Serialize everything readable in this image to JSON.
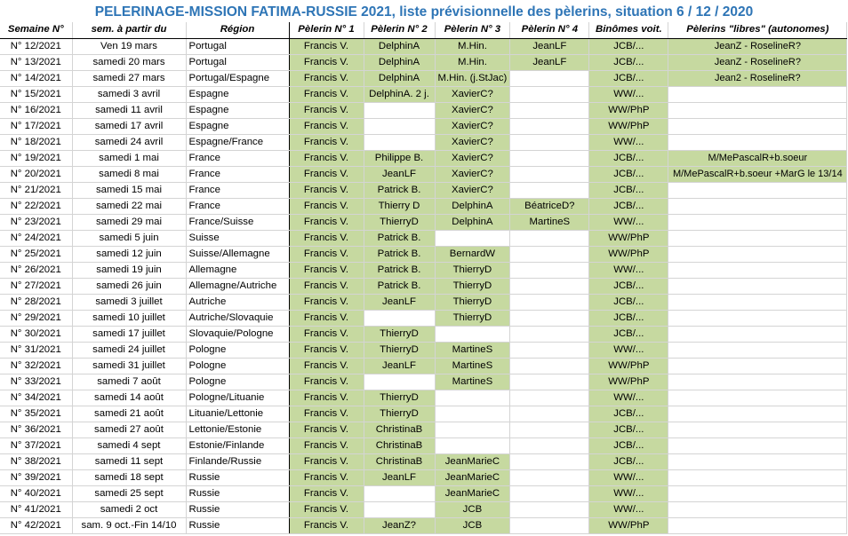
{
  "title": "PELERINAGE-MISSION FATIMA-RUSSIE 2021, liste prévisionnelle des pèlerins, situation 6 / 12 / 2020",
  "colors": {
    "title": "#2e75b6",
    "green_fill": "#c6d9a0"
  },
  "headers": [
    "Semaine N°",
    "sem. à partir du",
    "Région",
    "Pèlerin N° 1",
    "Pèlerin N° 2",
    "Pèlerin N° 3",
    "Pèlerin N° 4",
    "Binômes voit.",
    "Pèlerins \"libres\" (autonomes)"
  ],
  "rows": [
    {
      "week": "N° 12/2021",
      "date": "Ven 19 mars",
      "region": "Portugal",
      "p1": "Francis V.",
      "p2": "DelphinA",
      "p3": "M.Hin.",
      "p4": "JeanLF",
      "binome": "JCB/...",
      "libres": "JeanZ - RoselineR?"
    },
    {
      "week": "N° 13/2021",
      "date": "samedi 20 mars",
      "region": "Portugal",
      "p1": "Francis V.",
      "p2": "DelphinA",
      "p3": "M.Hin.",
      "p4": "JeanLF",
      "binome": "JCB/...",
      "libres": "JeanZ - RoselineR?"
    },
    {
      "week": "N° 14/2021",
      "date": "samedi 27 mars",
      "region": "Portugal/Espagne",
      "p1": "Francis V.",
      "p2": "DelphinA",
      "p3": "M.Hin. (j.StJac)",
      "p4": "",
      "binome": "JCB/...",
      "libres": "Jean2 - RoselineR?"
    },
    {
      "week": "N° 15/2021",
      "date": "samedi 3 avril",
      "region": "Espagne",
      "p1": "Francis V.",
      "p2": "DelphinA. 2 j.",
      "p3": "XavierC?",
      "p4": "",
      "binome": "WW/...",
      "libres": ""
    },
    {
      "week": "N° 16/2021",
      "date": "samedi 11 avril",
      "region": "Espagne",
      "p1": "Francis V.",
      "p2": "",
      "p3": "XavierC?",
      "p4": "",
      "binome": "WW/PhP",
      "libres": ""
    },
    {
      "week": "N° 17/2021",
      "date": "samedi 17 avril",
      "region": "Espagne",
      "p1": "Francis V.",
      "p2": "",
      "p3": "XavierC?",
      "p4": "",
      "binome": "WW/PhP",
      "libres": ""
    },
    {
      "week": "N° 18/2021",
      "date": "samedi 24 avril",
      "region": "Espagne/France",
      "p1": "Francis V.",
      "p2": "",
      "p3": "XavierC?",
      "p4": "",
      "binome": "WW/...",
      "libres": ""
    },
    {
      "week": "N° 19/2021",
      "date": "samedi 1 mai",
      "region": "France",
      "p1": "Francis V.",
      "p2": "Philippe B.",
      "p3": "XavierC?",
      "p4": "",
      "binome": "JCB/...",
      "libres": "M/MePascalR+b.soeur"
    },
    {
      "week": "N° 20/2021",
      "date": "samedi 8 mai",
      "region": "France",
      "p1": "Francis V.",
      "p2": "JeanLF",
      "p3": "XavierC?",
      "p4": "",
      "binome": "JCB/...",
      "libres": "M/MePascalR+b.soeur  +MarG le 13/14"
    },
    {
      "week": "N° 21/2021",
      "date": "samedi 15 mai",
      "region": "France",
      "p1": "Francis V.",
      "p2": "Patrick B.",
      "p3": "XavierC?",
      "p4": "",
      "binome": "JCB/...",
      "libres": ""
    },
    {
      "week": "N° 22/2021",
      "date": "samedi 22 mai",
      "region": "France",
      "p1": "Francis V.",
      "p2": "Thierry D",
      "p3": "DelphinA",
      "p4": "BéatriceD?",
      "binome": "JCB/...",
      "libres": ""
    },
    {
      "week": "N° 23/2021",
      "date": "samedi 29 mai",
      "region": "France/Suisse",
      "p1": "Francis V.",
      "p2": "ThierryD",
      "p3": "DelphinA",
      "p4": "MartineS",
      "binome": "WW/...",
      "libres": ""
    },
    {
      "week": "N° 24/2021",
      "date": "samedi 5 juin",
      "region": "Suisse",
      "p1": "Francis V.",
      "p2": "Patrick B.",
      "p3": "",
      "p4": "",
      "binome": "WW/PhP",
      "libres": ""
    },
    {
      "week": "N° 25/2021",
      "date": "samedi 12 juin",
      "region": "Suisse/Allemagne",
      "p1": "Francis V.",
      "p2": "Patrick B.",
      "p3": "BernardW",
      "p4": "",
      "binome": "WW/PhP",
      "libres": ""
    },
    {
      "week": "N° 26/2021",
      "date": "samedi 19 juin",
      "region": "Allemagne",
      "p1": "Francis V.",
      "p2": "Patrick B.",
      "p3": "ThierryD",
      "p4": "",
      "binome": "WW/...",
      "libres": ""
    },
    {
      "week": "N° 27/2021",
      "date": "samedi 26 juin",
      "region": "Allemagne/Autriche",
      "p1": "Francis V.",
      "p2": "Patrick B.",
      "p3": "ThierryD",
      "p4": "",
      "binome": "JCB/...",
      "libres": ""
    },
    {
      "week": "N° 28/2021",
      "date": "samedi 3 juillet",
      "region": "Autriche",
      "p1": "Francis V.",
      "p2": "JeanLF",
      "p3": "ThierryD",
      "p4": "",
      "binome": "JCB/...",
      "libres": ""
    },
    {
      "week": "N° 29/2021",
      "date": "samedi 10 juillet",
      "region": "Autriche/Slovaquie",
      "p1": "Francis V.",
      "p2": "",
      "p3": "ThierryD",
      "p4": "",
      "binome": "JCB/...",
      "libres": ""
    },
    {
      "week": "N° 30/2021",
      "date": "samedi 17 juillet",
      "region": "Slovaquie/Pologne",
      "p1": "Francis V.",
      "p2": "ThierryD",
      "p3": "",
      "p4": "",
      "binome": "JCB/...",
      "libres": ""
    },
    {
      "week": "N° 31/2021",
      "date": "samedi 24 juillet",
      "region": "Pologne",
      "p1": "Francis V.",
      "p2": "ThierryD",
      "p3": "MartineS",
      "p4": "",
      "binome": "WW/...",
      "libres": ""
    },
    {
      "week": "N° 32/2021",
      "date": "samedi 31 juillet",
      "region": "Pologne",
      "p1": "Francis V.",
      "p2": "JeanLF",
      "p3": "MartineS",
      "p4": "",
      "binome": "WW/PhP",
      "libres": ""
    },
    {
      "week": "N° 33/2021",
      "date": "samedi 7 août",
      "region": "Pologne",
      "p1": "Francis V.",
      "p2": "",
      "p3": "MartineS",
      "p4": "",
      "binome": "WW/PhP",
      "libres": ""
    },
    {
      "week": "N° 34/2021",
      "date": "samedi 14 août",
      "region": "Pologne/Lituanie",
      "p1": "Francis V.",
      "p2": "ThierryD",
      "p3": "",
      "p4": "",
      "binome": "WW/...",
      "libres": ""
    },
    {
      "week": "N° 35/2021",
      "date": "samedi 21 août",
      "region": "Lituanie/Lettonie",
      "p1": "Francis V.",
      "p2": "ThierryD",
      "p3": "",
      "p4": "",
      "binome": "JCB/...",
      "libres": ""
    },
    {
      "week": "N° 36/2021",
      "date": "samedi 27 août",
      "region": "Lettonie/Estonie",
      "p1": "Francis V.",
      "p2": "ChristinaB",
      "p3": "",
      "p4": "",
      "binome": "JCB/...",
      "libres": ""
    },
    {
      "week": "N° 37/2021",
      "date": "samedi 4 sept",
      "region": "Estonie/Finlande",
      "p1": "Francis V.",
      "p2": "ChristinaB",
      "p3": "",
      "p4": "",
      "binome": "JCB/...",
      "libres": ""
    },
    {
      "week": "N° 38/2021",
      "date": "samedi 11 sept",
      "region": "Finlande/Russie",
      "p1": "Francis V.",
      "p2": "ChristinaB",
      "p3": "JeanMarieC",
      "p4": "",
      "binome": "JCB/...",
      "libres": ""
    },
    {
      "week": "N° 39/2021",
      "date": "samedi 18 sept",
      "region": "Russie",
      "p1": "Francis V.",
      "p2": "JeanLF",
      "p3": "JeanMarieC",
      "p4": "",
      "binome": "WW/...",
      "libres": ""
    },
    {
      "week": "N° 40/2021",
      "date": "samedi 25 sept",
      "region": "Russie",
      "p1": "Francis V.",
      "p2": "",
      "p3": "JeanMarieC",
      "p4": "",
      "binome": "WW/...",
      "libres": ""
    },
    {
      "week": "N° 41/2021",
      "date": "samedi 2 oct",
      "region": "Russie",
      "p1": "Francis V.",
      "p2": "",
      "p3": "JCB",
      "p4": "",
      "binome": "WW/...",
      "libres": ""
    },
    {
      "week": "N° 42/2021",
      "date": "sam. 9 oct.-Fin 14/10",
      "region": "Russie",
      "p1": "Francis V.",
      "p2": "JeanZ?",
      "p3": "JCB",
      "p4": "",
      "binome": "WW/PhP",
      "libres": ""
    }
  ]
}
